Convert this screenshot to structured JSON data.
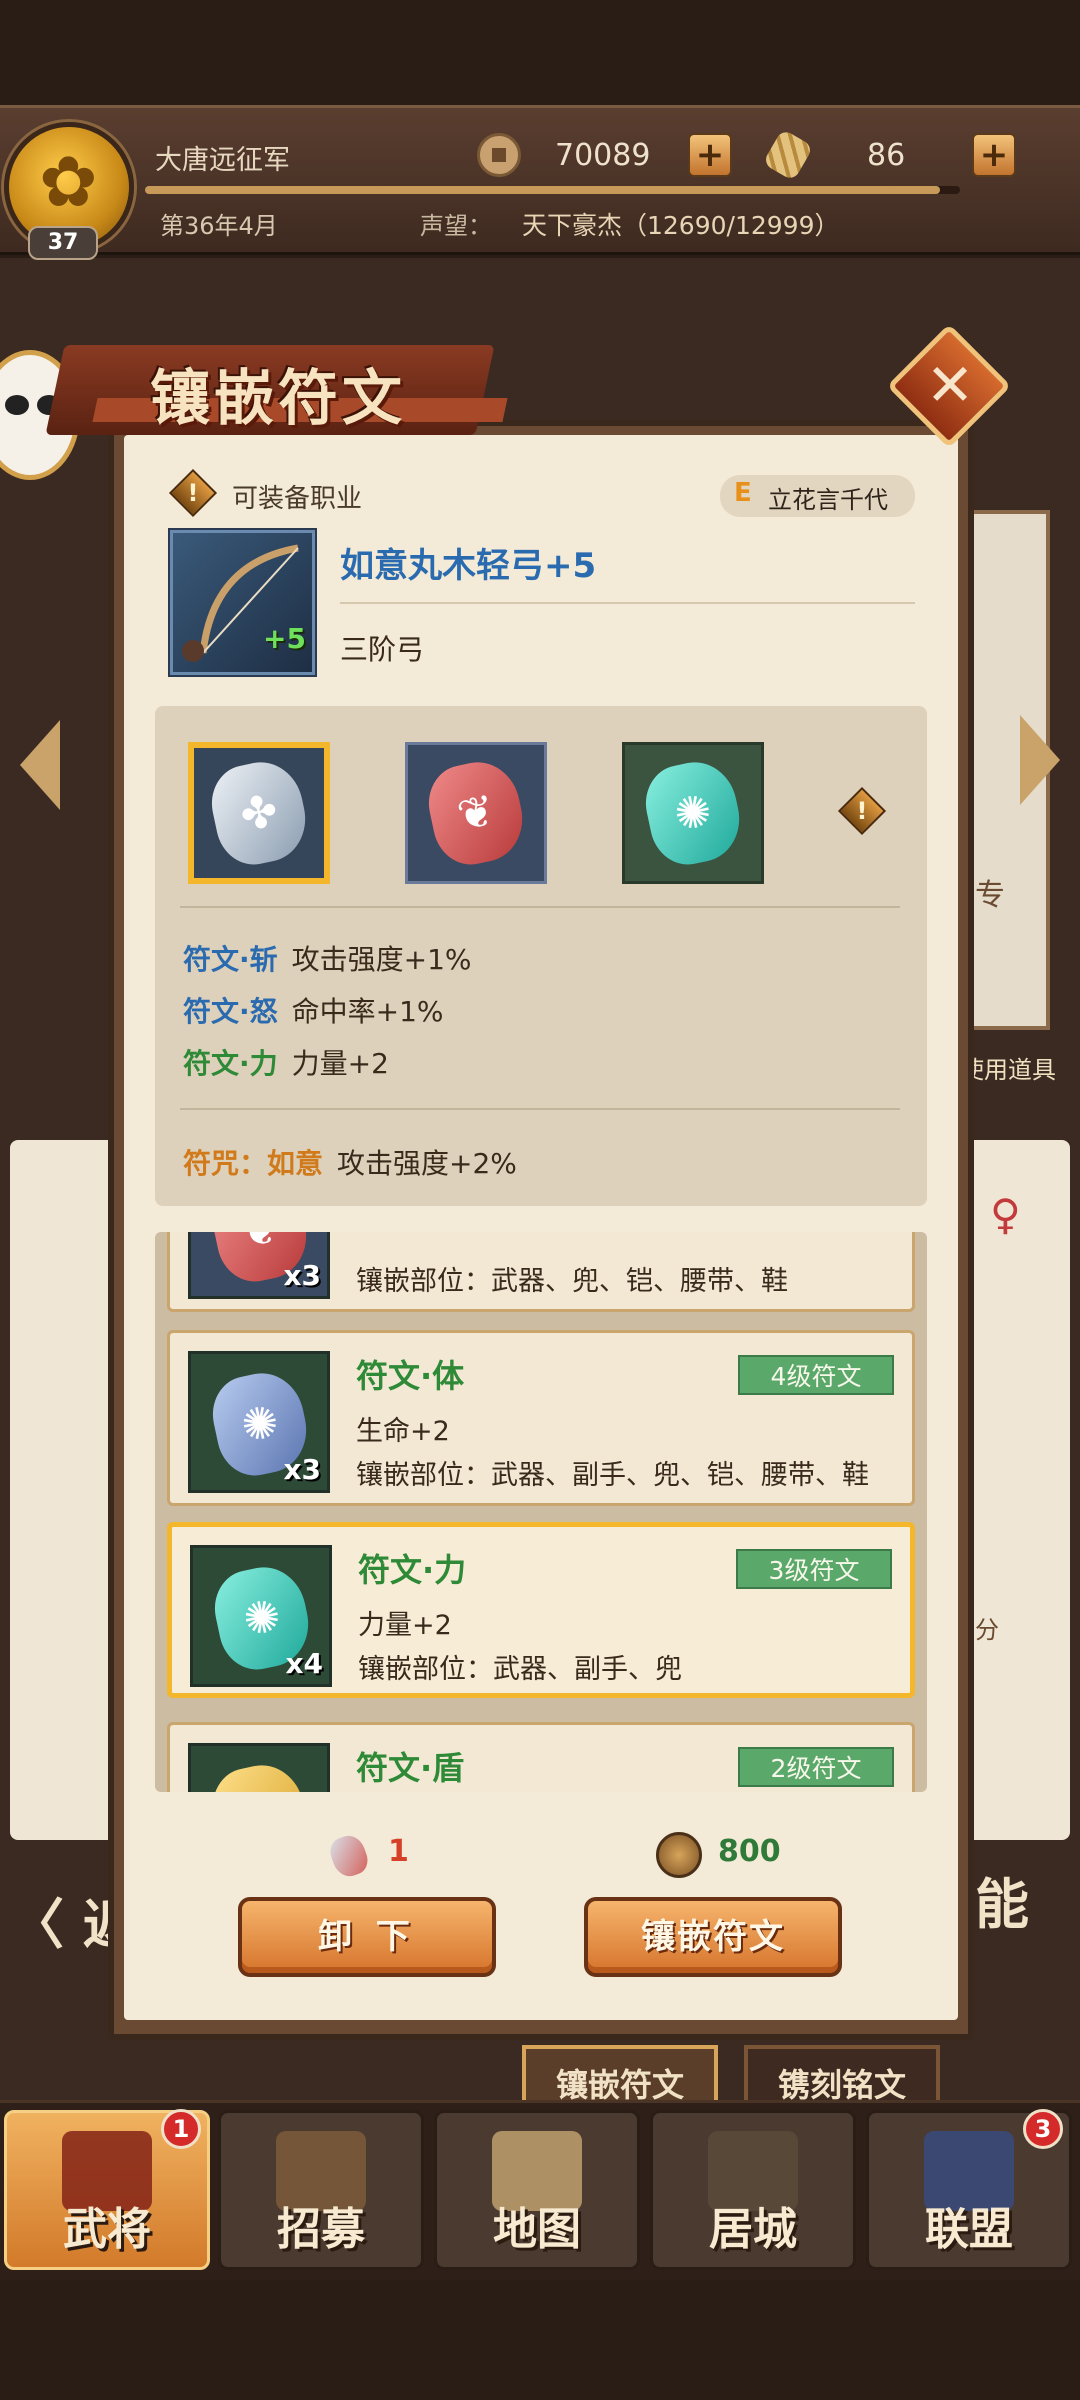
{
  "top_bar": {
    "army_name": "大唐远征军",
    "date": "第36年4月",
    "level": "37",
    "prestige_label": "声望：",
    "prestige_value": "天下豪杰（12690/12999）",
    "prestige_progress": 0.976,
    "coins": "70089",
    "gems": "86"
  },
  "background": {
    "back_text": "返",
    "skill_text": "能",
    "use_item_text": "使用道具",
    "special_text": "专",
    "portion_text": "分"
  },
  "modal": {
    "title": "镶嵌符文",
    "class_label": "可装备职业",
    "owner_grade": "E",
    "owner_name": "立花言千代",
    "item_name": "如意丸木轻弓+5",
    "item_enhance": "+5",
    "item_type": "三阶弓",
    "effects": [
      {
        "name": "符文·斩",
        "value": "攻击强度+1%",
        "color": "#2a6bb0"
      },
      {
        "name": "符文·怒",
        "value": "命中率+1%",
        "color": "#2a6bb0"
      },
      {
        "name": "符文·力",
        "value": "力量+2",
        "color": "#2f8a38"
      }
    ],
    "curse": {
      "name": "符咒：如意",
      "value": "攻击强度+2%",
      "color": "#d07a1c"
    },
    "rune_list": [
      {
        "title": "",
        "level": "",
        "effect": "",
        "slots": "镶嵌部位：武器、兜、铠、腰带、鞋",
        "count": "x3"
      },
      {
        "title": "符文·体",
        "level": "4级符文",
        "effect": "生命+2",
        "slots": "镶嵌部位：武器、副手、兜、铠、腰带、鞋",
        "count": "x3"
      },
      {
        "title": "符文·力",
        "level": "3级符文",
        "effect": "力量+2",
        "slots": "镶嵌部位：武器、副手、兜",
        "count": "x4"
      },
      {
        "title": "符文·盾",
        "level": "2级符文",
        "effect": "",
        "slots": "",
        "count": ""
      }
    ],
    "cost_runes": "1",
    "cost_coins": "800",
    "unequip_label": "卸 下",
    "inlay_label": "镶嵌符文"
  },
  "sub_tabs": [
    {
      "label": "镶嵌符文"
    },
    {
      "label": "镌刻铭文"
    }
  ],
  "bottom_nav": [
    {
      "label": "武将",
      "badge": "1"
    },
    {
      "label": "招募",
      "badge": ""
    },
    {
      "label": "地图",
      "badge": ""
    },
    {
      "label": "居城",
      "badge": ""
    },
    {
      "label": "联盟",
      "badge": "3"
    }
  ]
}
